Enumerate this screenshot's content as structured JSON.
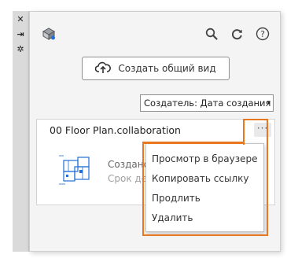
{
  "side_toolbar": {
    "close_icon": "close-icon",
    "dock_icon": "dock-icon",
    "settings_icon": "settings-icon",
    "close_glyph": "✕",
    "dock_glyph": "⇥",
    "settings_glyph": "✲"
  },
  "toolbar": {
    "logo_icon": "collaboration-logo-icon",
    "search_icon": "search-icon",
    "refresh_icon": "refresh-icon",
    "help_icon": "help-icon",
    "help_glyph": "?"
  },
  "create_button": {
    "label": "Создать общий вид",
    "icon": "cloud-upload-icon"
  },
  "sort": {
    "selected": "Создатель: Дата создания",
    "arrow": "▾"
  },
  "share_card": {
    "title": "00 Floor Plan.collaboration",
    "created_text": "Создано",
    "expires_text": "Срок де",
    "more_label": "···",
    "thumbnail_icon": "floor-plan-thumbnail"
  },
  "context_menu": {
    "items": [
      {
        "label": "Просмотр в браузере"
      },
      {
        "label": "Копировать ссылку"
      },
      {
        "label": "Продлить"
      },
      {
        "label": "Удалить"
      }
    ]
  },
  "colors": {
    "highlight": "#e87722",
    "panel_bg": "#f4f4f4",
    "accent_blue": "#1f6fd6"
  }
}
